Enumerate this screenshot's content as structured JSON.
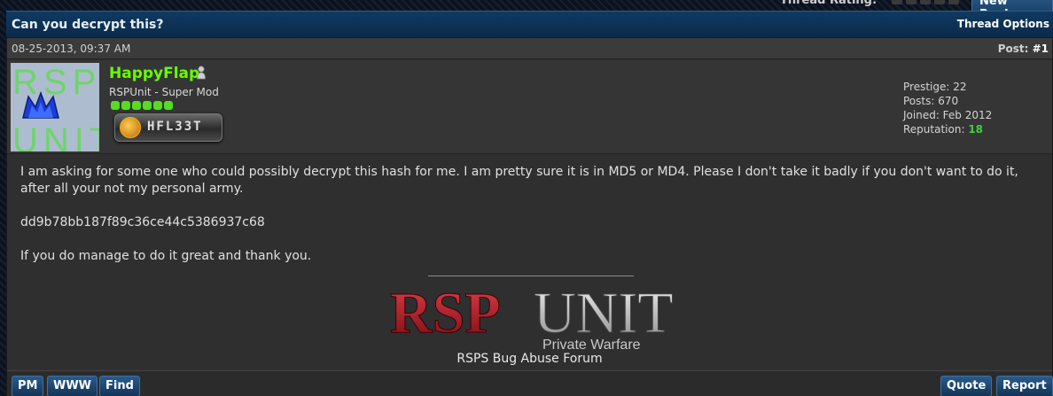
{
  "topbar": {
    "rating_label": "Thread Rating:",
    "new_reply_label": "New Reply"
  },
  "thread": {
    "title": "Can you decrypt this?",
    "options_label": "Thread Options"
  },
  "post": {
    "date": "08-25-2013, 09:37 AM",
    "number_prefix": "Post: ",
    "number": "#1",
    "user": {
      "avatar_text_top": "RSP",
      "avatar_text_bottom": "UNIT",
      "name": "HappyFlap",
      "title": "RSPUnit - Super Mod",
      "reputation_level": 6,
      "badge_text": "HFL33T",
      "prestige": "Prestige: 22",
      "posts": "Posts: 670",
      "joined": "Joined: Feb 2012",
      "reputation_label": "Reputation: ",
      "reputation_value": "18"
    },
    "message": {
      "para1": "I am asking for some one who could possibly decrypt this hash for me. I am pretty sure it is in MD5 or MD4. Please I don't take it badly if you don't want to do it, after all your not my personal army.",
      "hash": "dd9b78bb187f89c36ce44c5386937c68",
      "para3": "If you do manage to do it great and thank you."
    },
    "signature": {
      "logo_rsp": "RSP",
      "logo_unit": "UNIT",
      "logo_subtitle": "Private Warfare",
      "link_text": "RSPS Bug Abuse Forum"
    },
    "actions": {
      "pm": "PM",
      "www": "WWW",
      "find": "Find",
      "quote": "Quote",
      "report": "Report"
    }
  },
  "colors": {
    "username": "#66ff00",
    "reputation_value": "#3ed13e",
    "header_bg": "#0f3a63",
    "post_bg": "#2f2f2f",
    "logo_red": "#c0202a",
    "logo_silver": "#c8c8c8"
  }
}
